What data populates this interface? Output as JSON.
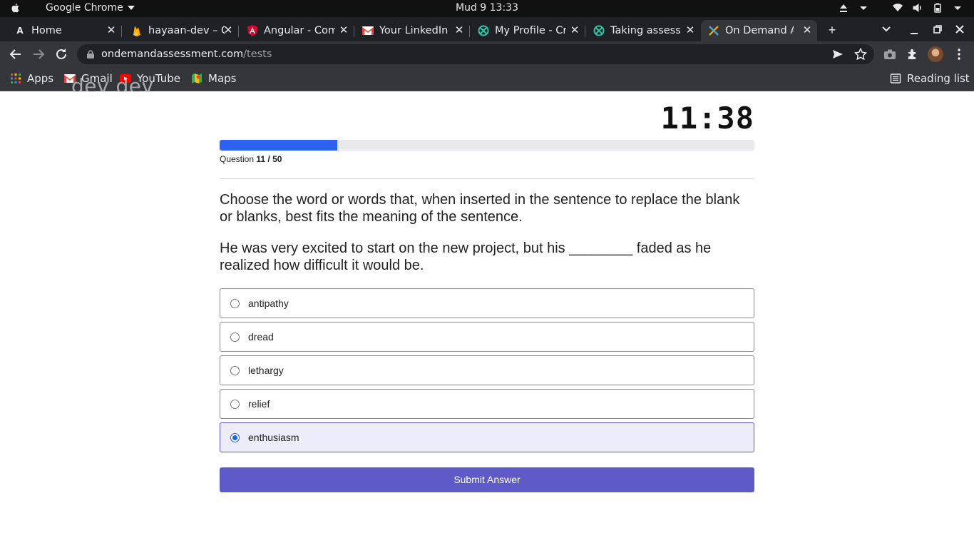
{
  "os_bar": {
    "app_name": "Google Chrome",
    "clock": "Mud 9  13:33"
  },
  "browser": {
    "tabs": [
      {
        "title": "Home",
        "icon": "a-icon"
      },
      {
        "title": "hayaan-dev – C",
        "icon": "firebase-icon"
      },
      {
        "title": "Angular - Com",
        "icon": "angular-icon"
      },
      {
        "title": "Your LinkedIn",
        "icon": "gmail-icon"
      },
      {
        "title": "My Profile - Cr",
        "icon": "crossover-icon"
      },
      {
        "title": "Taking assess",
        "icon": "crossover-icon"
      },
      {
        "title": "On Demand A",
        "icon": "ondemand-icon",
        "active": true
      }
    ],
    "url_domain": "ondemandassessment.com",
    "url_path": "/tests",
    "bookmarks": [
      {
        "label": "Apps",
        "icon": "apps-grid-icon"
      },
      {
        "label": "Gmail",
        "icon": "gmail-icon"
      },
      {
        "label": "YouTube",
        "icon": "youtube-icon"
      },
      {
        "label": "Maps",
        "icon": "maps-icon"
      }
    ],
    "reading_list": "Reading list",
    "watermark": "dev dev"
  },
  "assessment": {
    "timer": "11:38",
    "progress_fraction": 0.22,
    "question_label": "Question",
    "question_current": "11",
    "question_sep": " / ",
    "question_total": "50",
    "prompt": "Choose the word or words that, when inserted in the sentence to replace the blank or blanks, best fits the meaning of the sentence.",
    "sentence": "He was very excited to start on the new project, but his ________ faded as he realized how difficult it would be.",
    "options": [
      {
        "label": "antipathy",
        "selected": false
      },
      {
        "label": "dread",
        "selected": false
      },
      {
        "label": "lethargy",
        "selected": false
      },
      {
        "label": "relief",
        "selected": false
      },
      {
        "label": "enthusiasm",
        "selected": true
      }
    ],
    "submit_label": "Submit Answer"
  },
  "colors": {
    "progress": "#2d62f0",
    "submit": "#5e5ac8",
    "selected_bg": "#ececfa",
    "radio_checked": "#1a66e0"
  }
}
